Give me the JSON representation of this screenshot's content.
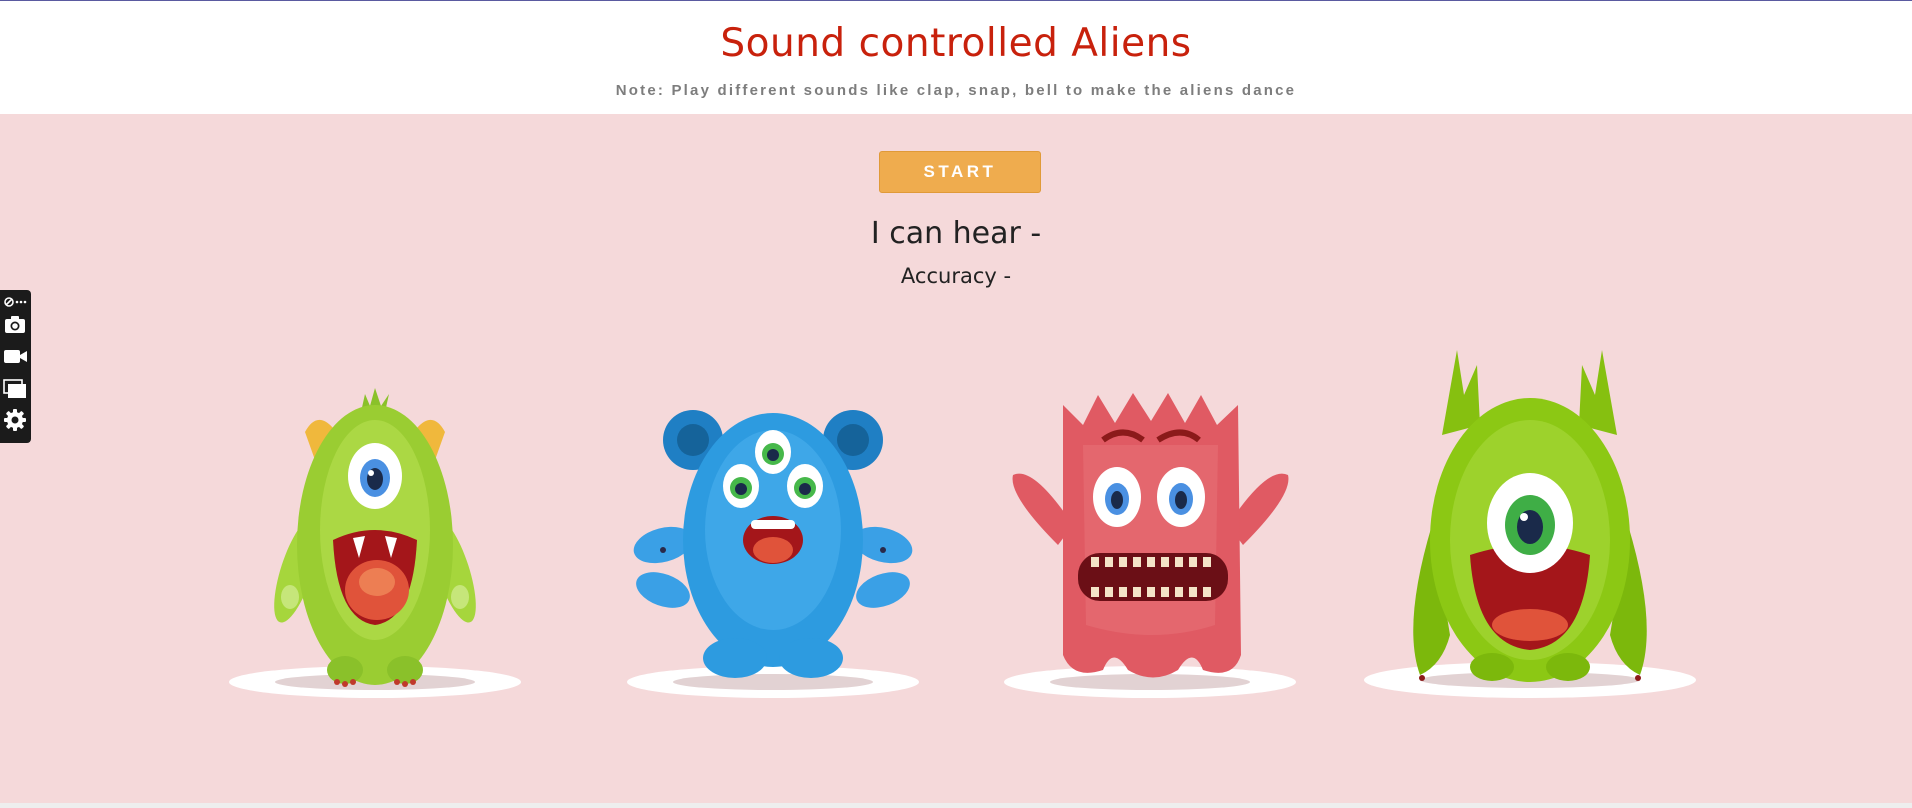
{
  "header": {
    "title": "Sound controlled Aliens",
    "note": "Note: Play different sounds like clap, snap, bell to make the aliens dance"
  },
  "controls": {
    "start_label": "START",
    "hear_label": "I can hear -",
    "accuracy_label": "Accuracy -"
  },
  "toolbar": {
    "items": [
      "extension-icon",
      "camera-icon",
      "video-icon",
      "windows-icon",
      "gear-icon"
    ]
  },
  "aliens": [
    {
      "name": "green-one-eyed-alien",
      "color": "#9acd32"
    },
    {
      "name": "blue-three-eyed-alien",
      "color": "#2d9be0"
    },
    {
      "name": "red-furry-alien",
      "color": "#e05a63"
    },
    {
      "name": "green-tall-alien",
      "color": "#8cc814"
    }
  ],
  "colors": {
    "title": "#c8210c",
    "stage_background": "#f5d9da",
    "start_button": "#efac4e"
  }
}
